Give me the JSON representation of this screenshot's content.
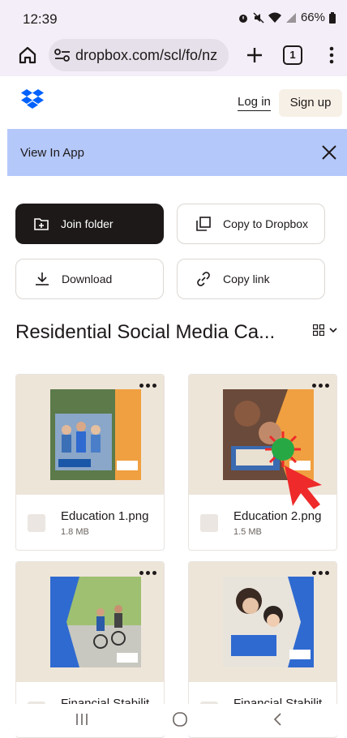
{
  "status_bar": {
    "time": "12:39",
    "battery": "66%"
  },
  "browser": {
    "url": "dropbox.com/scl/fo/nz",
    "tab_count": "1"
  },
  "header": {
    "login_label": "Log in",
    "signup_label": "Sign up"
  },
  "banner": {
    "label": "View In App"
  },
  "actions": {
    "join_folder": "Join folder",
    "copy_to_dropbox": "Copy to Dropbox",
    "download": "Download",
    "copy_link": "Copy link"
  },
  "folder": {
    "title": "Residential Social Media Ca..."
  },
  "files": [
    {
      "name": "Education 1.png",
      "size": "1.8 MB"
    },
    {
      "name": "Education 2.png",
      "size": "1.5 MB"
    },
    {
      "name": "Financial Stabilit...",
      "size": ""
    },
    {
      "name": "Financial Stabilit...",
      "size": ""
    }
  ],
  "colors": {
    "accent_dark": "#1e1919",
    "banner_blue": "#b4c8fa",
    "dropbox_blue": "#0061fe",
    "thumb_bg": "#eee5d9"
  }
}
